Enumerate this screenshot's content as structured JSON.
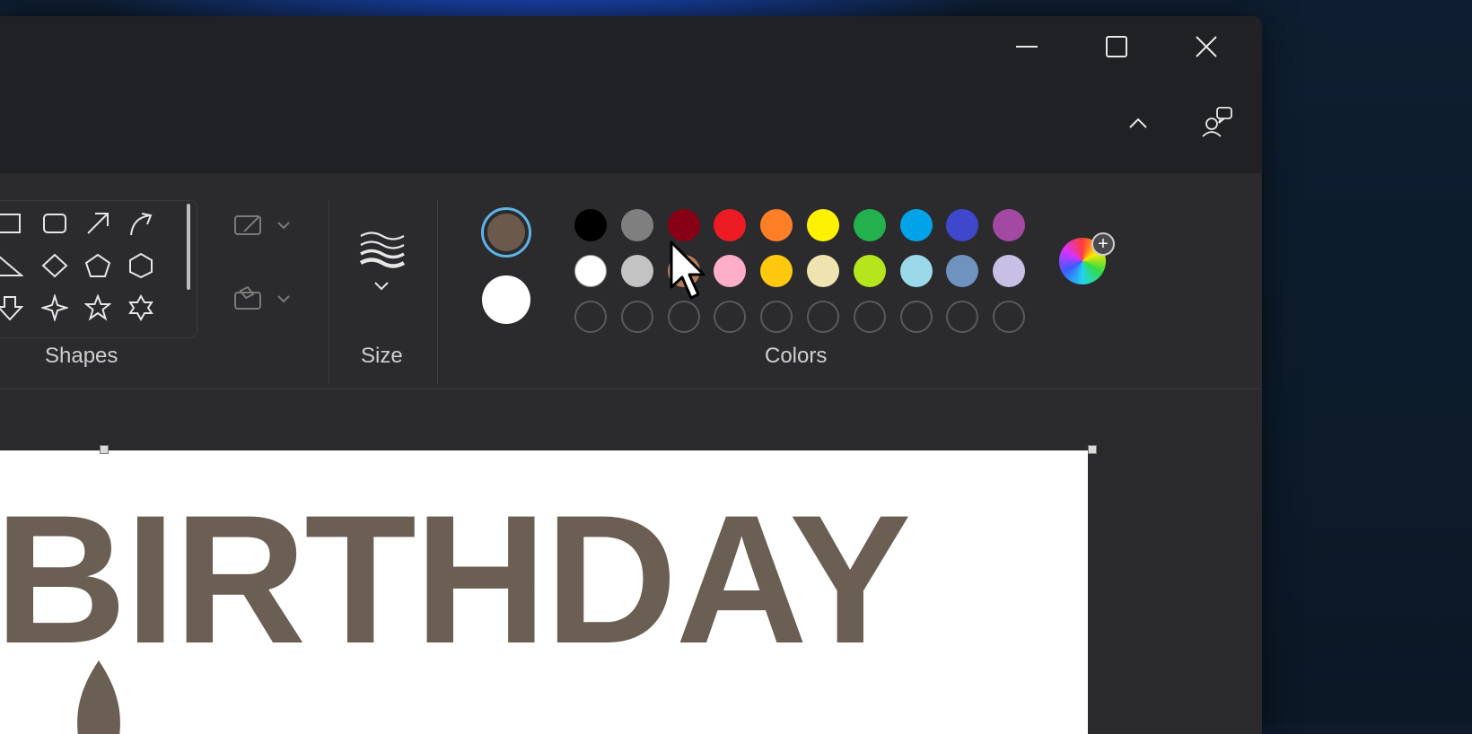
{
  "colors": {
    "primary_selected": "#6b5a4b",
    "secondary_selected": "#ffffff",
    "accent_ring": "#5fb3e6",
    "text_fill": "#6b5e52"
  },
  "ribbon": {
    "shapes": {
      "label": "Shapes"
    },
    "size": {
      "label": "Size"
    },
    "colors": {
      "label": "Colors",
      "palette_row1": [
        "#000000",
        "#7f7f7f",
        "#880015",
        "#ed1c24",
        "#ff7f27",
        "#fff200",
        "#22b14c",
        "#00a2e8",
        "#3f48cc",
        "#a349a4"
      ],
      "palette_row2": [
        "#ffffff",
        "#c3c3c3",
        "#b97a57",
        "#ffaec9",
        "#ffc90e",
        "#efe4b0",
        "#b5e61d",
        "#99d9ea",
        "#7092be",
        "#c8bfe7"
      ],
      "custom_slots": 10
    }
  },
  "canvas": {
    "text": "BIRTHDAY"
  }
}
